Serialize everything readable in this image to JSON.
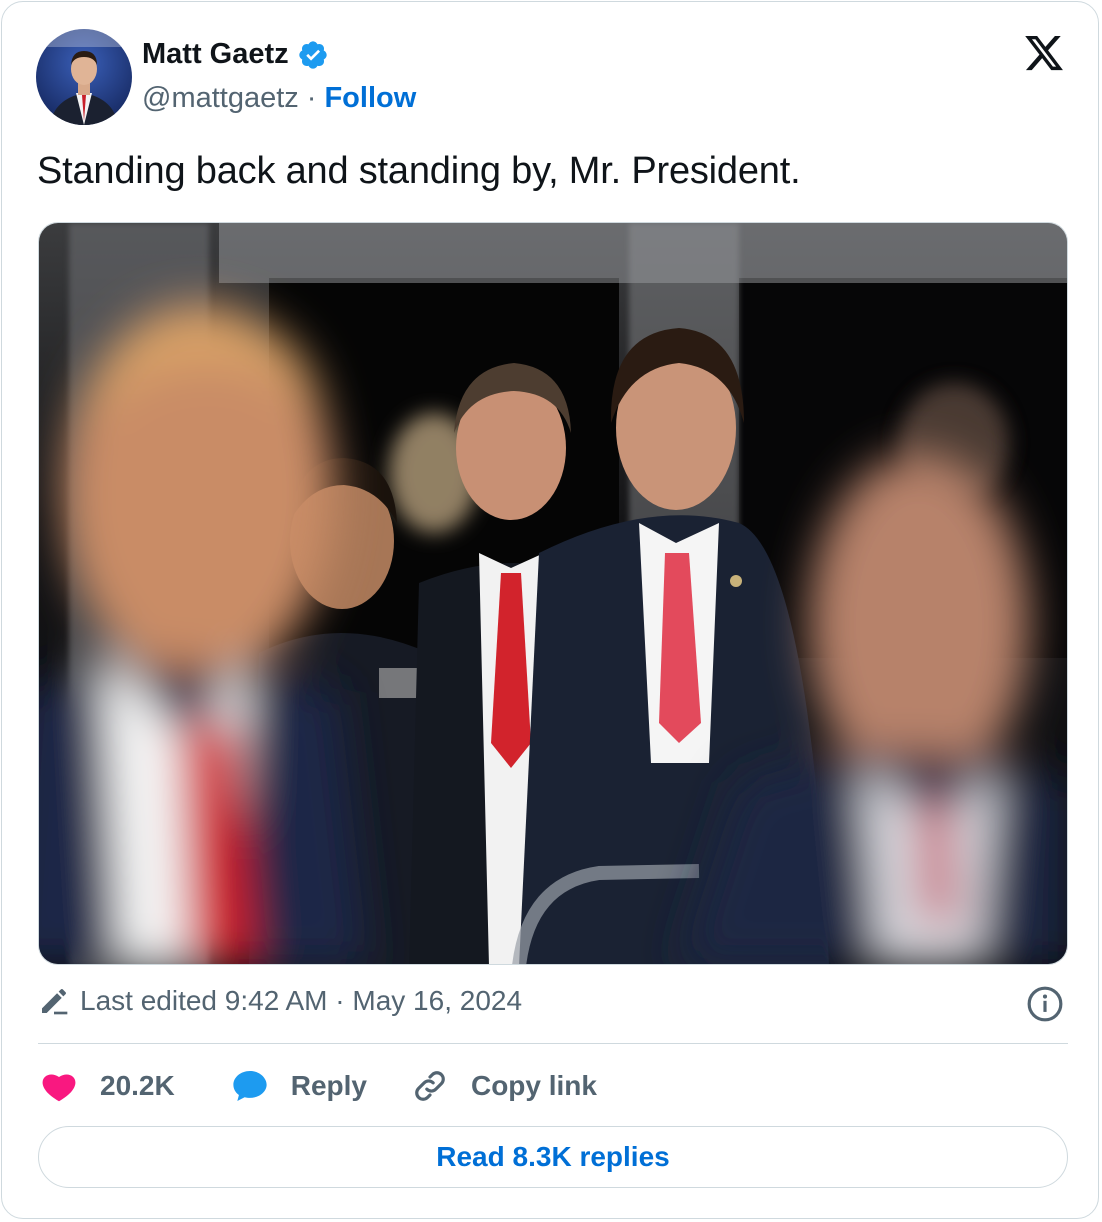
{
  "author": {
    "name": "Matt Gaetz",
    "handle": "@mattgaetz",
    "separator": "·",
    "follow_label": "Follow"
  },
  "tweet": {
    "text": "Standing back and standing by, Mr. President."
  },
  "meta": {
    "edited_label": "Last edited 9:42 AM · May 16, 2024"
  },
  "actions": {
    "likes_count": "20.2K",
    "reply_label": "Reply",
    "copy_link_label": "Copy link"
  },
  "read_replies_label": "Read 8.3K replies",
  "colors": {
    "accent": "#006fd6",
    "verified": "#1d9bf0",
    "like": "#f91880",
    "muted": "#536471"
  },
  "icons": {
    "platform": "x-logo-icon",
    "verified": "verified-badge-icon",
    "edit": "pencil-icon",
    "info": "info-icon",
    "like": "heart-icon",
    "reply": "speech-bubble-icon",
    "copy": "link-icon"
  }
}
